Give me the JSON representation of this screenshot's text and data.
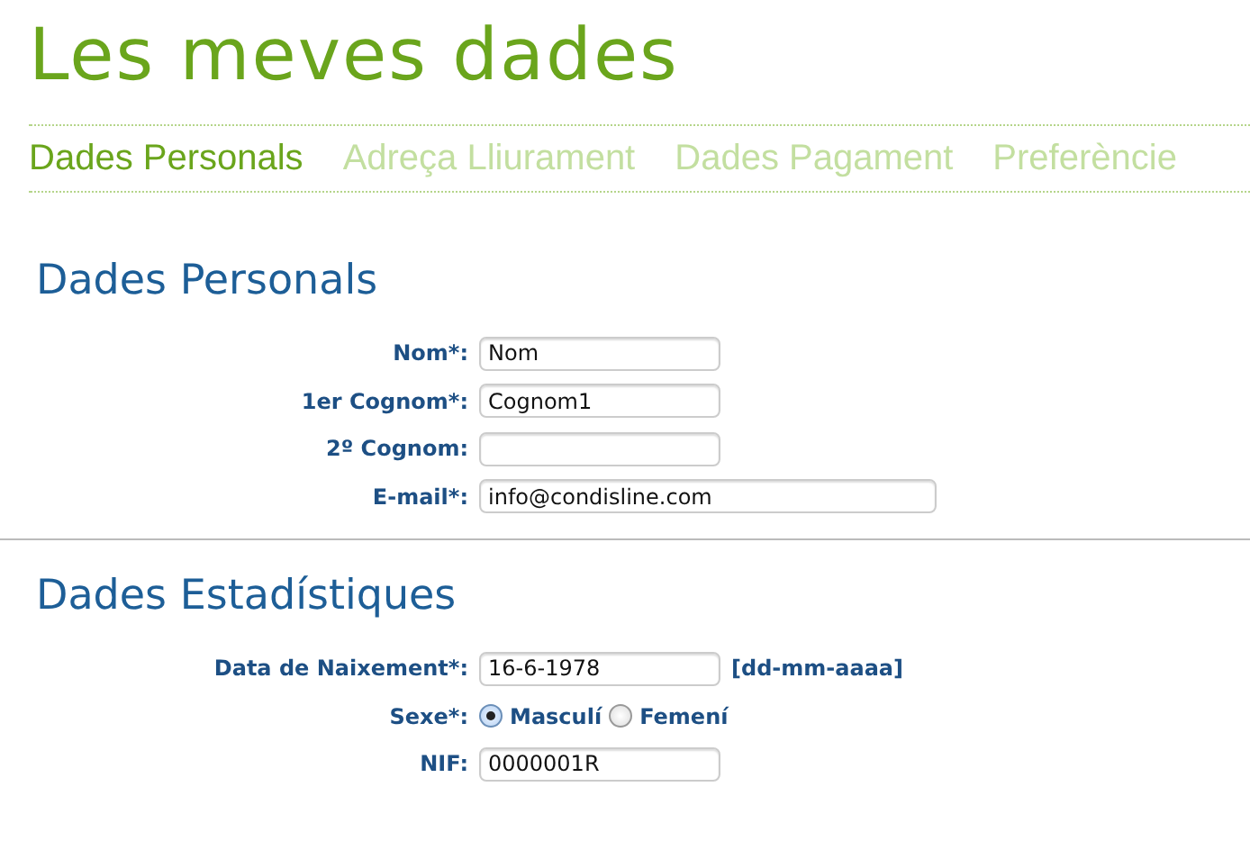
{
  "page_title": "Les meves dades",
  "tabs": [
    {
      "label": "Dades Personals",
      "selected": true
    },
    {
      "label": "Adreça Lliurament",
      "selected": false
    },
    {
      "label": "Dades Pagament",
      "selected": false
    },
    {
      "label": "Preferèncie",
      "selected": false
    }
  ],
  "sections": [
    {
      "heading": "Dades Personals",
      "fields": [
        {
          "kind": "text",
          "label": "Nom*:",
          "value": "Nom",
          "wide": false
        },
        {
          "kind": "text",
          "label": "1er Cognom*:",
          "value": "Cognom1",
          "wide": false
        },
        {
          "kind": "text",
          "label": "2º Cognom:",
          "wide": false
        },
        {
          "kind": "text",
          "label": "E-mail*:",
          "value": "info@condisline.com",
          "wide": true
        }
      ]
    },
    {
      "heading": "Dades Estadístiques",
      "fields": [
        {
          "kind": "text",
          "label": "Data de Naixement*:",
          "value": "16-6-1978",
          "wide": false,
          "hint": "[dd-mm-aaaa]"
        },
        {
          "kind": "radio",
          "label": "Sexe*:",
          "options": [
            {
              "label": "Masculí",
              "selected": true
            },
            {
              "label": "Femení",
              "selected": false
            }
          ]
        },
        {
          "kind": "text",
          "label": "NIF:",
          "value": "0000001R",
          "wide": false
        }
      ]
    }
  ]
}
